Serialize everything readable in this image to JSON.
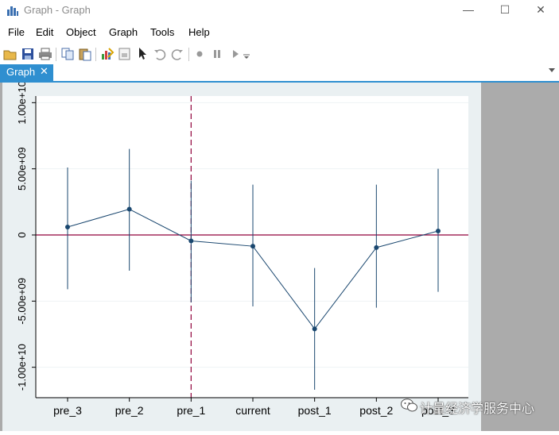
{
  "window": {
    "title": "Graph - Graph",
    "minimize": "—",
    "maximize": "☐",
    "close": "✕"
  },
  "menu": [
    "File",
    "Edit",
    "Object",
    "Graph",
    "Tools",
    "Help"
  ],
  "toolbar": {
    "icons": [
      "open-icon",
      "save-icon",
      "print-icon",
      "copy-icon",
      "paste-icon",
      "graph-editor-icon",
      "properties-icon",
      "pointer-icon",
      "undo-icon",
      "redo-icon",
      "record-icon",
      "pause-icon",
      "play-icon"
    ]
  },
  "tabs": [
    {
      "label": "Graph",
      "close": "✕"
    }
  ],
  "colors": {
    "series": "#1a476f",
    "reference_line": "#90003a",
    "accent": "#2f8fd0"
  },
  "chart_data": {
    "type": "scatter",
    "categories": [
      "pre_3",
      "pre_2",
      "pre_1",
      "current",
      "post_1",
      "post_2",
      "post_3"
    ],
    "estimates": [
      600000000,
      1950000000,
      -450000000,
      -850000000,
      -7100000000,
      -950000000,
      300000000
    ],
    "ci_lower": [
      -4100000000,
      -2700000000,
      -5100000000,
      -5400000000,
      -11700000000,
      -5500000000,
      -4300000000
    ],
    "ci_upper": [
      5100000000,
      6500000000,
      4100000000,
      3800000000,
      -2500000000,
      3800000000,
      5000000000
    ],
    "ylim": [
      -12300000000,
      10500000000
    ],
    "yticks": [
      -10000000000,
      -5000000000,
      0,
      5000000000,
      10000000000
    ],
    "yticklabels": [
      "-1.00e+10",
      "-5.00e+09",
      "0",
      "5.00e+09",
      "1.00e+10"
    ],
    "hline_y": 0,
    "vline_category": "pre_1",
    "grid": true,
    "xlabel": "",
    "ylabel": ""
  },
  "watermark": {
    "text": "计量经济学服务中心"
  }
}
